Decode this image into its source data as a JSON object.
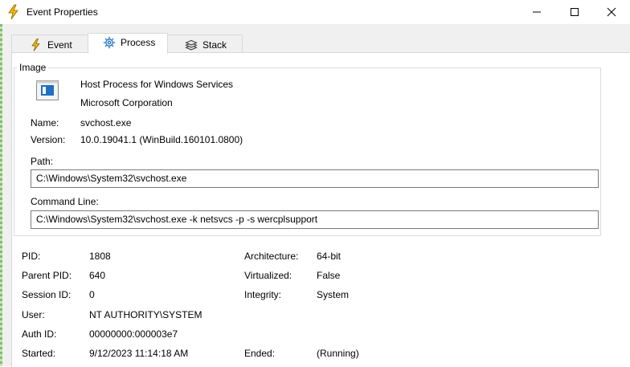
{
  "window": {
    "title": "Event Properties"
  },
  "tabs": [
    {
      "label": "Event",
      "icon": "lightning-icon"
    },
    {
      "label": "Process",
      "icon": "gear-icon"
    },
    {
      "label": "Stack",
      "icon": "stack-icon"
    }
  ],
  "image_group": {
    "title": "Image",
    "description": "Host Process for Windows Services",
    "company": "Microsoft Corporation",
    "name_label": "Name:",
    "name_value": "svchost.exe",
    "version_label": "Version:",
    "version_value": "10.0.19041.1 (WinBuild.160101.0800)",
    "path_label": "Path:",
    "path_value": "C:\\Windows\\System32\\svchost.exe",
    "cmd_label": "Command Line:",
    "cmd_value": "C:\\Windows\\System32\\svchost.exe -k netsvcs -p -s wercplsupport"
  },
  "details": {
    "pid_label": "PID:",
    "pid_value": "1808",
    "ppid_label": "Parent PID:",
    "ppid_value": "640",
    "session_label": "Session ID:",
    "session_value": "0",
    "user_label": "User:",
    "user_value": "NT AUTHORITY\\SYSTEM",
    "auth_label": "Auth ID:",
    "auth_value": "00000000:000003e7",
    "started_label": "Started:",
    "started_value": "9/12/2023 11:14:18 AM",
    "arch_label": "Architecture:",
    "arch_value": "64-bit",
    "virt_label": "Virtualized:",
    "virt_value": "False",
    "integrity_label": "Integrity:",
    "integrity_value": "System",
    "ended_label": "Ended:",
    "ended_value": "(Running)"
  },
  "colors": {
    "title_icon": "#f5b800",
    "accent_blue": "#1f6fc5"
  }
}
